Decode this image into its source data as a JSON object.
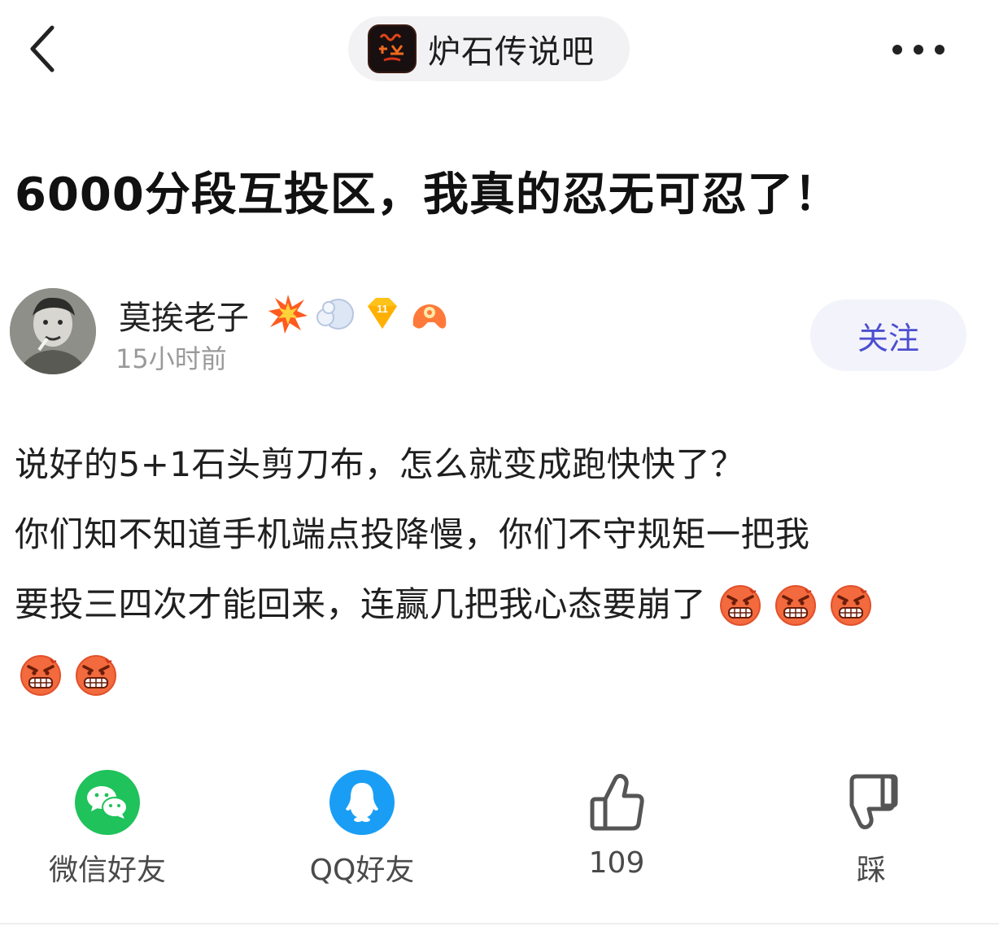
{
  "header": {
    "forum_name": "炉石传说吧",
    "back_icon": "chevron-left-icon",
    "more_icon": "more-horizontal-icon"
  },
  "post": {
    "title": "6000分段互投区，我真的忍无可忍了！",
    "author": {
      "name": "莫挨老子",
      "time": "15小时前",
      "level_badge": "11",
      "follow_label": "关注"
    },
    "content_lines": [
      "说好的5+1石头剪刀布，怎么就变成跑快快了？",
      "你们知不知道手机端点投降慢，你们不守规矩一把我",
      "要投三四次才能回来，连赢几把我心态要崩了"
    ],
    "emoji": "angry-grimace-emoji"
  },
  "actions": {
    "wechat_label": "微信好友",
    "qq_label": "QQ好友",
    "like_count": "109",
    "dislike_label": "踩"
  },
  "colors": {
    "follow_text": "#4b4fd0",
    "wechat_green": "#1fc25b",
    "qq_blue": "#1a9ef5",
    "emoji_orange": "#f26a3d"
  }
}
